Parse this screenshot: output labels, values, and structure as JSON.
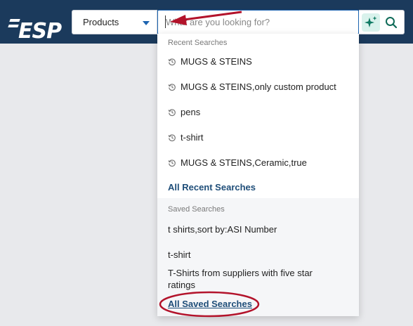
{
  "header": {
    "logo_text": "ESP",
    "category_select": {
      "value": "Products"
    },
    "search": {
      "placeholder": "What are you looking for?",
      "value": ""
    },
    "ai_button_icon": "sparkle-icon",
    "search_button_icon": "search-icon"
  },
  "dropdown": {
    "recent_title": "Recent Searches",
    "recent_items": [
      "MUGS & STEINS",
      "MUGS & STEINS,only custom product",
      "pens",
      "t-shirt",
      "MUGS & STEINS,Ceramic,true"
    ],
    "recent_icon": "history-icon",
    "all_recent_label": "All Recent Searches",
    "saved_title": "Saved Searches",
    "saved_items": [
      "t shirts,sort by:ASI Number",
      "t-shirt",
      "T-Shirts from suppliers with five star ratings"
    ],
    "all_saved_label": "All Saved Searches"
  },
  "colors": {
    "header_bg": "#1b3a5c",
    "link": "#1f4e79",
    "annotation_red": "#b3132b",
    "ai_bg": "#d9f2ec"
  }
}
